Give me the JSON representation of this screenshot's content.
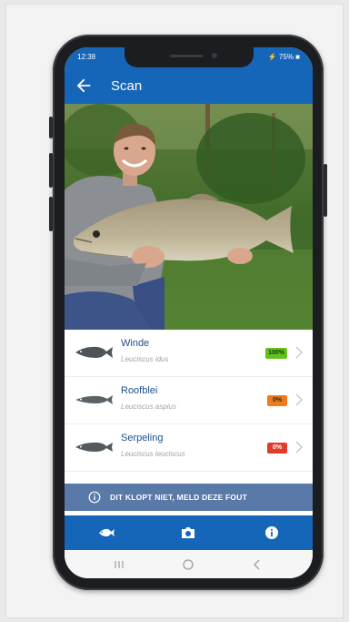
{
  "status_bar": {
    "time": "12:38",
    "indicators": "⚡ 75% ■"
  },
  "app_bar": {
    "back_icon": "arrow-left-icon",
    "title": "Scan"
  },
  "photo": {
    "description": "man holding a large fish outdoors"
  },
  "results": [
    {
      "name": "Winde",
      "latin": "Leuciscus idus",
      "confidence": "100%",
      "badge_color": "#62c31a"
    },
    {
      "name": "Roofblei",
      "latin": "Leuciscus aspius",
      "confidence": "0%",
      "badge_color": "#f07a1e"
    },
    {
      "name": "Serpeling",
      "latin": "Leuciscus leuciscus",
      "confidence": "0%",
      "badge_color": "#e33b2a"
    }
  ],
  "report_button": {
    "label": "DIT KLOPT NIET, MELD DEZE FOUT",
    "icon": "info-circle-icon"
  },
  "bottom_nav": [
    {
      "icon": "fish-icon"
    },
    {
      "icon": "camera-icon"
    },
    {
      "icon": "info-icon"
    }
  ],
  "system_nav": [
    {
      "icon": "recent-apps-icon"
    },
    {
      "icon": "home-icon"
    },
    {
      "icon": "back-icon"
    }
  ],
  "colors": {
    "primary": "#1565b8",
    "report_bg": "#5979a8",
    "title_text": "#1b4f8e"
  }
}
